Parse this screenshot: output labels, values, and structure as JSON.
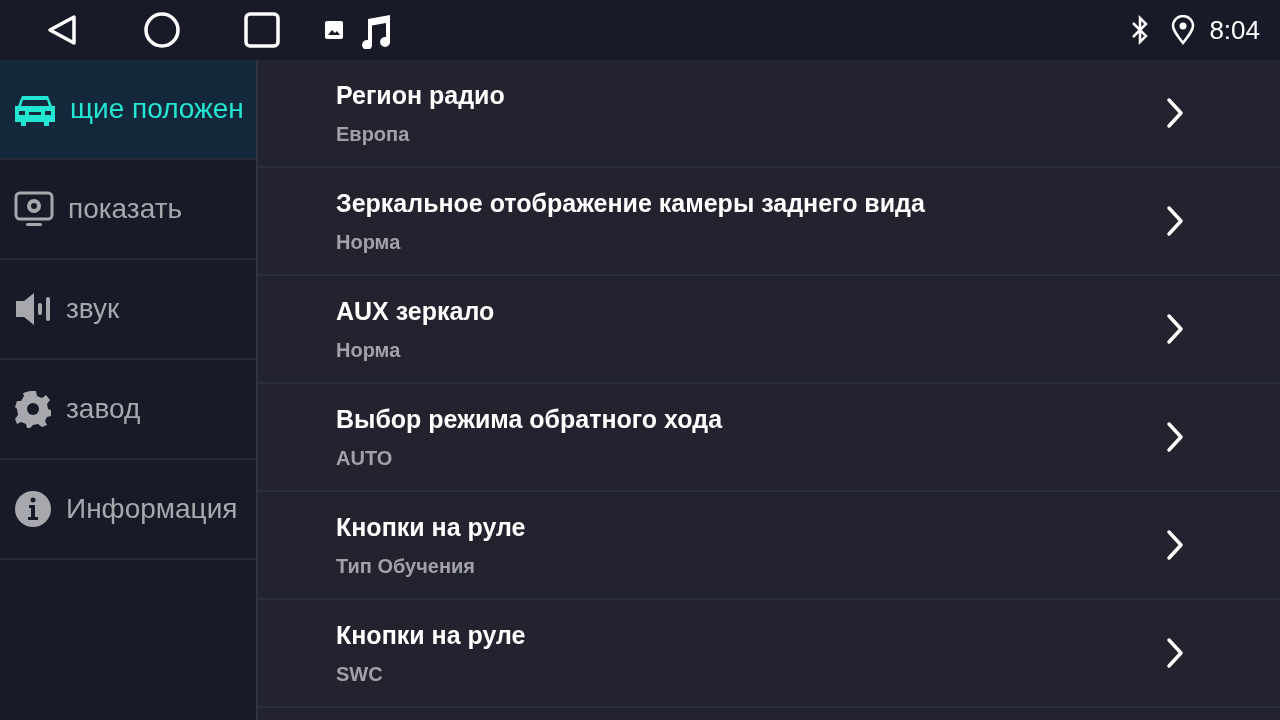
{
  "status_bar": {
    "time": "8:04"
  },
  "sidebar": {
    "items": [
      {
        "label": "щие положен",
        "kind": "car",
        "selected": true
      },
      {
        "label": "показать",
        "kind": "display",
        "selected": false
      },
      {
        "label": "звук",
        "kind": "speaker",
        "selected": false
      },
      {
        "label": "завод",
        "kind": "gear",
        "selected": false
      },
      {
        "label": "Информация",
        "kind": "info",
        "selected": false
      }
    ]
  },
  "settings": [
    {
      "title": "Регион радио",
      "value": "Европа"
    },
    {
      "title": "Зеркальное отображение камеры заднего вида",
      "value": "Норма"
    },
    {
      "title": "AUX зеркало",
      "value": "Норма"
    },
    {
      "title": "Выбор режима обратного хода",
      "value": "AUTO"
    },
    {
      "title": "Кнопки на руле",
      "value": "Тип Обучения"
    },
    {
      "title": "Кнопки на руле",
      "value": "SWC"
    }
  ]
}
